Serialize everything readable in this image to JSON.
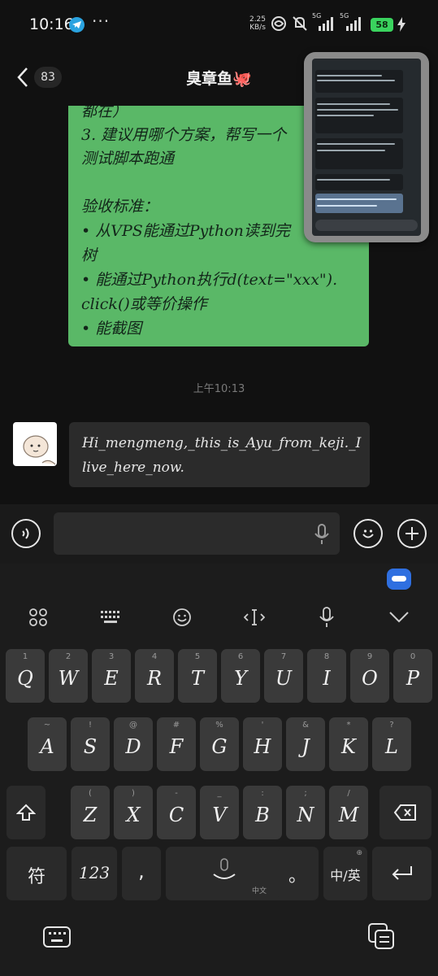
{
  "status": {
    "time": "10:16",
    "more": "···",
    "net_speed_value": "2.25",
    "net_speed_unit": "KB/s",
    "signal_1": "5G",
    "signal_2": "5G",
    "battery": "58"
  },
  "header": {
    "unread_count": "83",
    "title": "臭章鱼🐙"
  },
  "messages": {
    "outgoing_lines": [
      "都在）",
      "3. 建议用哪个方案，帮写一个",
      "测试脚本跑通",
      "",
      "验收标准：",
      "• 从VPS能通过Python读到完",
      "树",
      "• 能通过Python执行d(text=\"xxx\").",
      "click()或等价操作",
      "• 能截图"
    ],
    "timestamp": "上午10:13",
    "incoming_lines": [
      "Hi_mengmeng,_this_is_Ayu_from_keji._I",
      "live_here_now."
    ]
  },
  "keyboard": {
    "row1": [
      {
        "sub": "1",
        "key": "Q"
      },
      {
        "sub": "2",
        "key": "W"
      },
      {
        "sub": "3",
        "key": "E"
      },
      {
        "sub": "4",
        "key": "R"
      },
      {
        "sub": "5",
        "key": "T"
      },
      {
        "sub": "6",
        "key": "Y"
      },
      {
        "sub": "7",
        "key": "U"
      },
      {
        "sub": "8",
        "key": "I"
      },
      {
        "sub": "9",
        "key": "O"
      },
      {
        "sub": "0",
        "key": "P"
      }
    ],
    "row2": [
      {
        "sub": "~",
        "key": "A"
      },
      {
        "sub": "!",
        "key": "S"
      },
      {
        "sub": "@",
        "key": "D"
      },
      {
        "sub": "#",
        "key": "F"
      },
      {
        "sub": "%",
        "key": "G"
      },
      {
        "sub": "'",
        "key": "H"
      },
      {
        "sub": "&",
        "key": "J"
      },
      {
        "sub": "*",
        "key": "K"
      },
      {
        "sub": "?",
        "key": "L"
      }
    ],
    "row3": [
      {
        "sub": "(",
        "key": "Z"
      },
      {
        "sub": ")",
        "key": "X"
      },
      {
        "sub": "-",
        "key": "C"
      },
      {
        "sub": "_",
        "key": "V"
      },
      {
        "sub": ":",
        "key": "B"
      },
      {
        "sub": ";",
        "key": "N"
      },
      {
        "sub": "/",
        "key": "M"
      }
    ],
    "symbols_label": "符",
    "numbers_label": "123",
    "comma_label": ",",
    "space_sub_label": "中文",
    "period_label": "。",
    "lang_label": "中/英"
  },
  "colors": {
    "outgoing_bubble": "#5ab867",
    "incoming_bubble": "#2b2b2b",
    "battery": "#3ad35e",
    "telegram": "#2aa3e0"
  }
}
